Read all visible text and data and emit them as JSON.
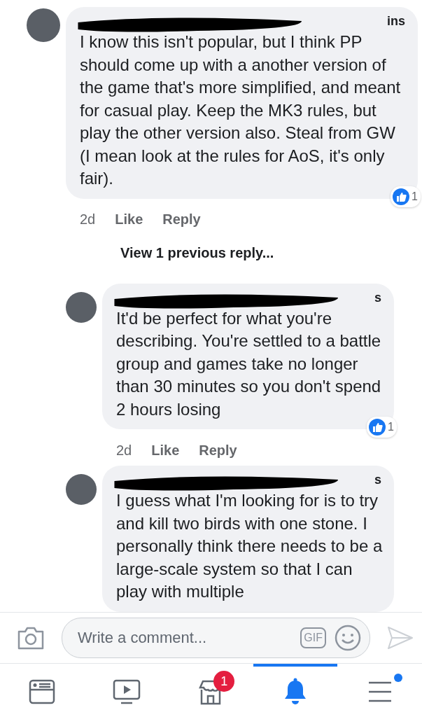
{
  "comments": [
    {
      "kind": "comment",
      "name_fragment": "ins",
      "text": "I know this isn't popular, but I think PP should come up with a another version of the game that's more simplified, and meant for casual play. Keep the MK3 rules, but play the other version also. Steal from GW (I mean look at the rules for AoS, it's only fair).",
      "time": "2d",
      "like": "Like",
      "reply_label": "Reply",
      "reactions": "1"
    },
    {
      "kind": "link",
      "text": "View 1 previous reply..."
    },
    {
      "kind": "reply",
      "name_fragment": "s",
      "text": "It'd be perfect for what you're describing. You're settled to a battle group and games take no longer than 30 minutes so you don't spend 2 hours losing",
      "time": "2d",
      "like": "Like",
      "reply_label": "Reply",
      "reactions": "1"
    },
    {
      "kind": "reply",
      "name_fragment": "s",
      "text": "I guess what I'm looking for is to try and kill two birds with one stone. I personally think there needs to be a large-scale system so that I can play with multiple"
    }
  ],
  "composer": {
    "placeholder": "Write a comment...",
    "gif": "GIF"
  },
  "tabs": [
    {
      "selected": false
    },
    {
      "selected": false
    },
    {
      "selected": false,
      "badge": "1"
    },
    {
      "selected": true
    },
    {
      "selected": false,
      "dot": true
    }
  ]
}
